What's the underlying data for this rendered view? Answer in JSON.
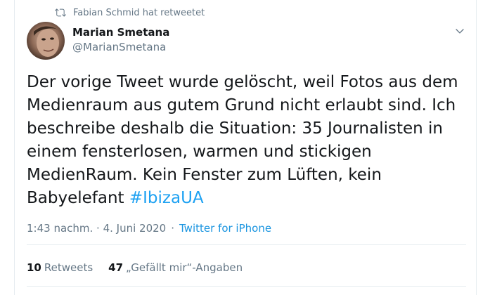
{
  "retweet_context": {
    "label": "Fabian Schmid hat retweetet",
    "icon": "retweet-icon"
  },
  "author": {
    "name": "Marian Smetana",
    "handle": "@MarianSmetana",
    "avatar": "avatar-photo"
  },
  "tweet": {
    "text": "Der vorige Tweet wurde gelöscht, weil Fotos aus dem Medienraum aus gutem Grund nicht erlaubt sind. Ich beschreibe deshalb die Situation: 35 Journalisten in einem fensterlosen, warmen und stickigen MedienRaum. Kein Fenster zum Lüften, kein Babyelefant",
    "hashtag": "#IbizaUA",
    "time": "1:43 nachm. · 4. Juni 2020",
    "separator": "·",
    "source": "Twitter for iPhone"
  },
  "stats": {
    "retweets_count": "10",
    "retweets_label": "Retweets",
    "likes_count": "47",
    "likes_label": "„Gefällt mir“-Angaben"
  },
  "colors": {
    "accent": "#1da1f2",
    "text": "#14171a",
    "muted": "#657786",
    "border": "#e6ecf0"
  }
}
